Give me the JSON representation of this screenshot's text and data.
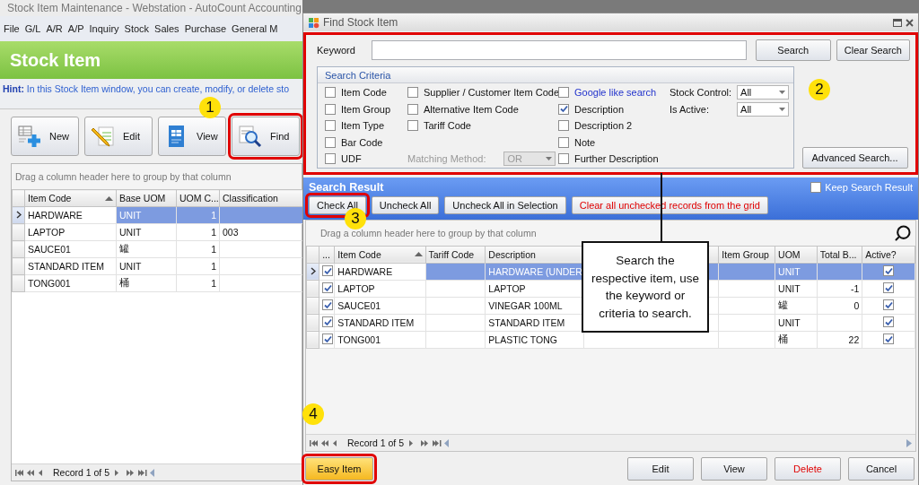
{
  "main_window": {
    "title": "Stock Item Maintenance - Webstation - AutoCount Accounting",
    "menu": [
      "File",
      "G/L",
      "A/R",
      "A/P",
      "Inquiry",
      "Stock",
      "Sales",
      "Purchase",
      "General M"
    ],
    "header": "Stock Item",
    "hint": "**Hint:** In this Stock Item window, you can create, modify, or delete sto",
    "toolbar": [
      {
        "label": "New",
        "kind": "new",
        "highlighted": false
      },
      {
        "label": "Edit",
        "kind": "edit",
        "highlighted": false
      },
      {
        "label": "View",
        "kind": "view",
        "highlighted": false
      },
      {
        "label": "Find",
        "kind": "find",
        "highlighted": true,
        "badge": "1"
      }
    ],
    "grid": {
      "group_hint": "Drag a column header here to group by that column",
      "columns": [
        {
          "label": "Item Code",
          "sorted": true
        },
        {
          "label": "Base UOM",
          "sorted": false
        },
        {
          "label": "UOM C...",
          "sorted": false
        },
        {
          "label": "Classification",
          "sorted": false
        }
      ],
      "rows": [
        {
          "selected": true,
          "cells": [
            "HARDWARE",
            "UNIT",
            "1",
            null
          ]
        },
        {
          "selected": false,
          "cells": [
            "LAPTOP",
            "UNIT",
            "1",
            "003"
          ]
        },
        {
          "selected": false,
          "cells": [
            "SAUCE01",
            "罐",
            "1",
            null
          ]
        },
        {
          "selected": false,
          "cells": [
            "STANDARD ITEM",
            "UNIT",
            "1",
            null
          ]
        },
        {
          "selected": false,
          "cells": [
            "TONG001",
            "桶",
            "1",
            null
          ]
        }
      ],
      "navigator": "Record 1 of 5"
    }
  },
  "dialog": {
    "title": "Find Stock Item",
    "search": {
      "highlighted": true,
      "badge": "2",
      "keyword_label": "Keyword",
      "buttons": [
        "Search",
        "Clear Search"
      ],
      "criteria": {
        "title": "Search Criteria",
        "columns": [
          [
            {
              "label": "Item Code",
              "checked": false,
              "kind": "plain"
            },
            {
              "label": "Item Group",
              "checked": false,
              "kind": "plain"
            },
            {
              "label": "Item Type",
              "checked": false,
              "kind": "plain"
            },
            {
              "label": "Bar Code",
              "checked": false,
              "kind": "plain"
            },
            {
              "label": "UDF",
              "checked": false,
              "kind": "plain"
            }
          ],
          [
            {
              "label": "Supplier / Customer Item Code",
              "checked": false,
              "kind": "plain"
            },
            {
              "label": "Alternative Item Code",
              "checked": false,
              "kind": "plain"
            },
            {
              "label": "Tariff Code",
              "checked": false,
              "kind": "plain"
            }
          ],
          [
            {
              "label": "Google like search",
              "checked": false,
              "kind": "accent"
            },
            {
              "label": "Description",
              "checked": true,
              "kind": "plain"
            },
            {
              "label": "Description 2",
              "checked": false,
              "kind": "plain"
            },
            {
              "label": "Note",
              "checked": false,
              "kind": "plain"
            },
            {
              "label": "Further Description",
              "checked": false,
              "kind": "plain"
            }
          ]
        ],
        "matching_method": {
          "label": "Matching Method:",
          "value": "OR",
          "disabled": true
        },
        "filters": [
          {
            "label": "Stock Control:",
            "value": "All"
          },
          {
            "label": "Is Active:",
            "value": "All"
          }
        ]
      },
      "advanced_button": "Advanced Search..."
    },
    "result": {
      "title": "Search Result",
      "keep_result": {
        "label": "Keep Search Result",
        "checked": false
      },
      "buttons": [
        {
          "label": "Check All",
          "kind": "normal",
          "highlighted": true,
          "badge": "3"
        },
        {
          "label": "Uncheck All",
          "kind": "normal",
          "highlighted": false
        },
        {
          "label": "Uncheck All in Selection",
          "kind": "normal",
          "highlighted": false
        },
        {
          "label": "Clear all unchecked records from the grid",
          "kind": "warning",
          "highlighted": false
        }
      ],
      "group_hint": "Drag a column header here to group by that column",
      "check_column": "...",
      "columns": [
        {
          "label": "Item Code",
          "sorted": true
        },
        {
          "label": "Tariff Code",
          "sorted": false
        },
        {
          "label": "Description",
          "sorted": false
        },
        {},
        {
          "label": "Item Group",
          "sorted": false
        },
        {
          "label": "UOM",
          "sorted": false
        },
        {
          "label": "Total B...",
          "sorted": false
        }
      ],
      "active_column": "Active?",
      "rows": [
        {
          "selected": true,
          "checked": true,
          "active": true,
          "cells": [
            "HARDWARE",
            null,
            "HARDWARE (UNDER",
            null,
            null,
            "UNIT",
            null
          ]
        },
        {
          "selected": false,
          "checked": true,
          "active": true,
          "cells": [
            "LAPTOP",
            null,
            "LAPTOP",
            null,
            null,
            "UNIT",
            "-1"
          ]
        },
        {
          "selected": false,
          "checked": true,
          "active": true,
          "cells": [
            "SAUCE01",
            null,
            "VINEGAR 100ML",
            null,
            null,
            "罐",
            "0"
          ]
        },
        {
          "selected": false,
          "checked": true,
          "active": true,
          "cells": [
            "STANDARD ITEM",
            null,
            "STANDARD ITEM",
            null,
            null,
            "UNIT",
            null
          ]
        },
        {
          "selected": false,
          "checked": true,
          "active": true,
          "cells": [
            "TONG001",
            null,
            "PLASTIC TONG",
            null,
            null,
            "桶",
            "22"
          ]
        }
      ],
      "navigator": "Record 1 of 5",
      "navigator_badge": "4"
    },
    "footer": [
      {
        "label": "Easy Item",
        "kind": "accent",
        "highlighted": true
      },
      {
        "label": "Edit",
        "kind": "normal",
        "highlighted": false
      },
      {
        "label": "View",
        "kind": "normal",
        "highlighted": false
      },
      {
        "label": "Delete",
        "kind": "danger",
        "highlighted": false
      },
      {
        "label": "Cancel",
        "kind": "normal",
        "highlighted": false
      }
    ],
    "callout": "Search the respective item, use the keyword or criteria to search."
  }
}
